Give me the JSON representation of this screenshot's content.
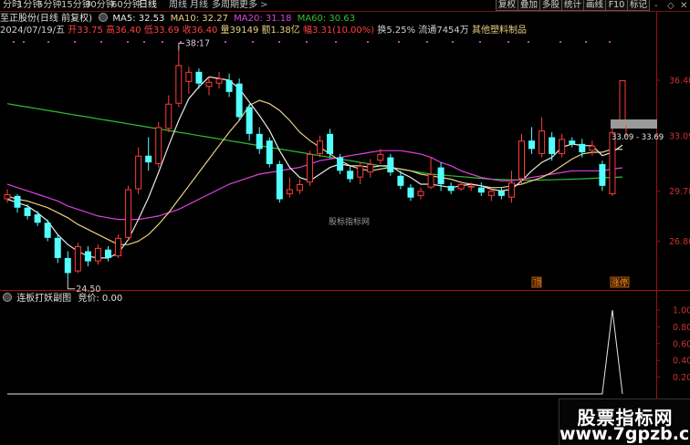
{
  "toolbar": {
    "tabs": [
      "分时",
      "1分钟",
      "5分钟",
      "15分钟",
      "30分钟",
      "60分钟",
      "日线",
      "周线",
      "月线",
      "多周期",
      "更多"
    ],
    "more_arrow": ">",
    "right_buttons": [
      "复权",
      "叠加",
      "多股",
      "统计",
      "画线",
      "F10",
      "标记"
    ],
    "controls": [
      "-",
      "◇",
      "✕"
    ]
  },
  "info": {
    "stock_name": "至正股份(日线 前复权)",
    "ma5": "MA5: 32.53",
    "ma10": "MA10: 32.27",
    "ma20": "MA20: 31.18",
    "ma60": "MA60: 30.63"
  },
  "quote": {
    "date": "2024/07/19/五",
    "open": "开33.75",
    "high": "高36.40",
    "low": "低33.69",
    "close": "收36.40",
    "volume": "量39149",
    "amount": "额1.38亿",
    "change": "幅3.31(10.00%)",
    "turnover": "换5.25%",
    "float": "流通7454万",
    "industry": "其他塑料制品"
  },
  "chart_data": {
    "type": "candlestick",
    "yaxis_ticks": [
      "36.40",
      "33.09",
      "29.78",
      "26.80"
    ],
    "high_label": "38.17",
    "low_label": "24.50",
    "range_label": "33.09 - 33.69",
    "markers": [
      "顶",
      "涨停"
    ],
    "sub_ticks": [
      "1.00",
      "0.80",
      "0.60",
      "0.40",
      "0.20"
    ],
    "colors": {
      "up": "#ff3c3c",
      "down": "#54ffff",
      "ma5": "#e8e8e8",
      "ma10": "#e8d080",
      "ma20": "#e040e0",
      "ma60": "#30c030"
    },
    "candles": [
      {
        "o": 29.3,
        "c": 29.6,
        "h": 29.9,
        "l": 29.1
      },
      {
        "o": 29.5,
        "c": 28.8,
        "h": 29.6,
        "l": 28.5
      },
      {
        "o": 28.8,
        "c": 28.3,
        "h": 29.0,
        "l": 28.1
      },
      {
        "o": 28.4,
        "c": 27.9,
        "h": 28.6,
        "l": 27.7
      },
      {
        "o": 27.9,
        "c": 27.0,
        "h": 28.1,
        "l": 26.8
      },
      {
        "o": 27.0,
        "c": 25.8,
        "h": 27.2,
        "l": 25.5
      },
      {
        "o": 25.8,
        "c": 24.9,
        "h": 26.2,
        "l": 24.5
      },
      {
        "o": 25.0,
        "c": 26.5,
        "h": 26.7,
        "l": 24.9
      },
      {
        "o": 26.2,
        "c": 25.6,
        "h": 26.5,
        "l": 25.3
      },
      {
        "o": 25.6,
        "c": 26.4,
        "h": 26.6,
        "l": 25.4
      },
      {
        "o": 26.3,
        "c": 25.8,
        "h": 26.5,
        "l": 25.6
      },
      {
        "o": 25.9,
        "c": 27.0,
        "h": 27.2,
        "l": 25.8
      },
      {
        "o": 27.0,
        "c": 29.9,
        "h": 30.1,
        "l": 26.9
      },
      {
        "o": 29.9,
        "c": 31.9,
        "h": 32.4,
        "l": 29.6
      },
      {
        "o": 31.9,
        "c": 31.5,
        "h": 33.0,
        "l": 31.0
      },
      {
        "o": 31.4,
        "c": 33.6,
        "h": 33.9,
        "l": 31.2
      },
      {
        "o": 33.5,
        "c": 35.0,
        "h": 35.5,
        "l": 33.3
      },
      {
        "o": 35.0,
        "c": 37.3,
        "h": 38.17,
        "l": 34.8
      },
      {
        "o": 36.3,
        "c": 36.9,
        "h": 37.2,
        "l": 35.6
      },
      {
        "o": 36.9,
        "c": 36.2,
        "h": 37.1,
        "l": 35.9
      },
      {
        "o": 36.0,
        "c": 36.3,
        "h": 36.6,
        "l": 35.5
      },
      {
        "o": 36.2,
        "c": 36.5,
        "h": 36.9,
        "l": 35.9
      },
      {
        "o": 36.4,
        "c": 35.7,
        "h": 36.8,
        "l": 35.4
      },
      {
        "o": 36.2,
        "c": 34.2,
        "h": 36.5,
        "l": 34.0
      },
      {
        "o": 34.8,
        "c": 33.2,
        "h": 35.0,
        "l": 32.8
      },
      {
        "o": 33.2,
        "c": 32.3,
        "h": 33.6,
        "l": 32.0
      },
      {
        "o": 32.8,
        "c": 31.4,
        "h": 33.0,
        "l": 31.2
      },
      {
        "o": 31.4,
        "c": 29.3,
        "h": 31.6,
        "l": 29.1
      },
      {
        "o": 29.6,
        "c": 29.9,
        "h": 30.6,
        "l": 29.4
      },
      {
        "o": 29.8,
        "c": 30.2,
        "h": 30.5,
        "l": 29.6
      },
      {
        "o": 30.3,
        "c": 32.0,
        "h": 32.2,
        "l": 30.1
      },
      {
        "o": 32.0,
        "c": 32.8,
        "h": 33.1,
        "l": 31.8
      },
      {
        "o": 33.2,
        "c": 32.0,
        "h": 33.5,
        "l": 31.8
      },
      {
        "o": 31.8,
        "c": 31.0,
        "h": 32.0,
        "l": 30.8
      },
      {
        "o": 31.0,
        "c": 30.5,
        "h": 31.3,
        "l": 30.3
      },
      {
        "o": 30.6,
        "c": 31.3,
        "h": 31.5,
        "l": 30.2
      },
      {
        "o": 30.9,
        "c": 31.4,
        "h": 31.7,
        "l": 30.6
      },
      {
        "o": 31.6,
        "c": 32.0,
        "h": 32.3,
        "l": 31.4
      },
      {
        "o": 31.8,
        "c": 30.9,
        "h": 32.0,
        "l": 30.7
      },
      {
        "o": 30.7,
        "c": 30.1,
        "h": 31.0,
        "l": 29.9
      },
      {
        "o": 30.0,
        "c": 29.4,
        "h": 30.2,
        "l": 29.2
      },
      {
        "o": 29.5,
        "c": 29.8,
        "h": 30.0,
        "l": 29.3
      },
      {
        "o": 30.0,
        "c": 30.8,
        "h": 31.8,
        "l": 29.9
      },
      {
        "o": 31.2,
        "c": 30.2,
        "h": 31.5,
        "l": 29.8
      },
      {
        "o": 30.1,
        "c": 29.8,
        "h": 30.3,
        "l": 29.6
      },
      {
        "o": 29.9,
        "c": 30.2,
        "h": 30.4,
        "l": 29.8
      },
      {
        "o": 30.0,
        "c": 30.1,
        "h": 30.3,
        "l": 29.8
      },
      {
        "o": 30.0,
        "c": 29.7,
        "h": 30.3,
        "l": 29.5
      },
      {
        "o": 29.5,
        "c": 29.8,
        "h": 30.0,
        "l": 29.2
      },
      {
        "o": 29.8,
        "c": 29.5,
        "h": 30.0,
        "l": 29.3
      },
      {
        "o": 29.4,
        "c": 30.3,
        "h": 31.0,
        "l": 29.1
      },
      {
        "o": 30.5,
        "c": 32.8,
        "h": 33.2,
        "l": 30.2
      },
      {
        "o": 32.8,
        "c": 32.3,
        "h": 33.6,
        "l": 32.0
      },
      {
        "o": 32.0,
        "c": 33.4,
        "h": 34.2,
        "l": 31.8
      },
      {
        "o": 33.0,
        "c": 32.0,
        "h": 33.3,
        "l": 31.6
      },
      {
        "o": 32.0,
        "c": 32.9,
        "h": 33.2,
        "l": 31.8
      },
      {
        "o": 32.8,
        "c": 32.6,
        "h": 33.0,
        "l": 32.4
      },
      {
        "o": 32.6,
        "c": 32.1,
        "h": 32.9,
        "l": 31.8
      },
      {
        "o": 32.2,
        "c": 32.5,
        "h": 32.8,
        "l": 31.9
      },
      {
        "o": 31.4,
        "c": 30.1,
        "h": 31.6,
        "l": 29.8
      },
      {
        "o": 29.6,
        "c": 33.3,
        "h": 33.6,
        "l": 29.5
      },
      {
        "o": 33.75,
        "c": 36.4,
        "h": 36.4,
        "l": 33.69
      }
    ],
    "ma5": [
      29.3,
      29.1,
      28.9,
      28.5,
      28.0,
      27.2,
      26.6,
      26.2,
      25.9,
      25.8,
      25.8,
      26.1,
      26.9,
      28.1,
      29.4,
      30.9,
      32.5,
      34.0,
      35.3,
      36.0,
      36.6,
      36.5,
      36.4,
      35.9,
      35.1,
      34.3,
      33.4,
      32.2,
      31.2,
      30.6,
      30.4,
      30.8,
      31.2,
      31.4,
      31.3,
      31.3,
      31.2,
      31.3,
      31.3,
      30.9,
      30.6,
      30.2,
      30.2,
      30.1,
      30.0,
      30.1,
      30.2,
      30.1,
      29.9,
      29.8,
      29.9,
      30.4,
      31.0,
      31.5,
      31.8,
      32.4,
      32.6,
      32.5,
      32.5,
      31.9,
      32.1,
      32.53
    ],
    "ma10": [
      29.5,
      29.3,
      29.2,
      29.0,
      28.8,
      28.5,
      28.2,
      27.8,
      27.5,
      27.2,
      26.9,
      26.6,
      26.6,
      26.8,
      27.2,
      27.8,
      28.5,
      29.3,
      30.1,
      30.9,
      31.7,
      32.5,
      33.3,
      34.0,
      34.9,
      35.2,
      35.0,
      34.6,
      34.0,
      33.3,
      32.8,
      32.4,
      32.0,
      31.6,
      31.3,
      31.1,
      31.0,
      31.1,
      31.2,
      31.1,
      31.0,
      30.8,
      30.7,
      30.6,
      30.5,
      30.3,
      30.2,
      30.1,
      30.0,
      30.0,
      30.1,
      30.2,
      30.4,
      30.6,
      30.9,
      31.3,
      31.7,
      32.0,
      32.1,
      32.1,
      32.3,
      32.27
    ],
    "ma20": [
      30.2,
      30.0,
      29.8,
      29.6,
      29.4,
      29.2,
      28.9,
      28.7,
      28.5,
      28.3,
      28.2,
      28.1,
      28.1,
      28.1,
      28.2,
      28.3,
      28.5,
      28.7,
      29.0,
      29.3,
      29.6,
      29.9,
      30.2,
      30.4,
      30.6,
      30.8,
      30.9,
      31.0,
      31.1,
      31.2,
      31.4,
      31.6,
      31.7,
      31.8,
      31.9,
      32.0,
      32.1,
      32.2,
      32.2,
      32.2,
      32.1,
      32.0,
      31.8,
      31.5,
      31.3,
      31.0,
      30.8,
      30.6,
      30.5,
      30.4,
      30.4,
      30.5,
      30.6,
      30.7,
      30.8,
      30.9,
      31.0,
      31.0,
      31.0,
      31.0,
      31.1,
      31.18
    ],
    "ma60": [
      35.0,
      34.9,
      34.8,
      34.7,
      34.6,
      34.5,
      34.4,
      34.3,
      34.2,
      34.1,
      34.0,
      33.9,
      33.8,
      33.7,
      33.6,
      33.5,
      33.4,
      33.3,
      33.2,
      33.1,
      33.0,
      32.9,
      32.8,
      32.7,
      32.6,
      32.5,
      32.4,
      32.3,
      32.2,
      32.1,
      32.0,
      31.9,
      31.8,
      31.7,
      31.6,
      31.5,
      31.4,
      31.3,
      31.2,
      31.1,
      31.0,
      30.9,
      30.8,
      30.75,
      30.7,
      30.65,
      30.6,
      30.55,
      30.5,
      30.48,
      30.46,
      30.45,
      30.44,
      30.45,
      30.46,
      30.48,
      30.5,
      30.52,
      30.55,
      30.58,
      30.6,
      30.63
    ],
    "sub_values": [
      0,
      0,
      0,
      0,
      0,
      0,
      0,
      0,
      0,
      0,
      0,
      0,
      0,
      0,
      0,
      0,
      0,
      0,
      0,
      0,
      0,
      0,
      0,
      0,
      0,
      0,
      0,
      0,
      0,
      0,
      0,
      0,
      0,
      0,
      0,
      0,
      0,
      0,
      0,
      0,
      0,
      0,
      0,
      0,
      0,
      0,
      0,
      0,
      0,
      0,
      0,
      0,
      0,
      0,
      0,
      0,
      0,
      0,
      0,
      0,
      1,
      0
    ]
  },
  "sub_panel": {
    "title": "连板打妖副图",
    "bid": "竞价: 0.00"
  },
  "center_watermark": "股标指标网",
  "watermark": {
    "line1": "股票指标网",
    "line2": "www.7gpzb.com"
  }
}
